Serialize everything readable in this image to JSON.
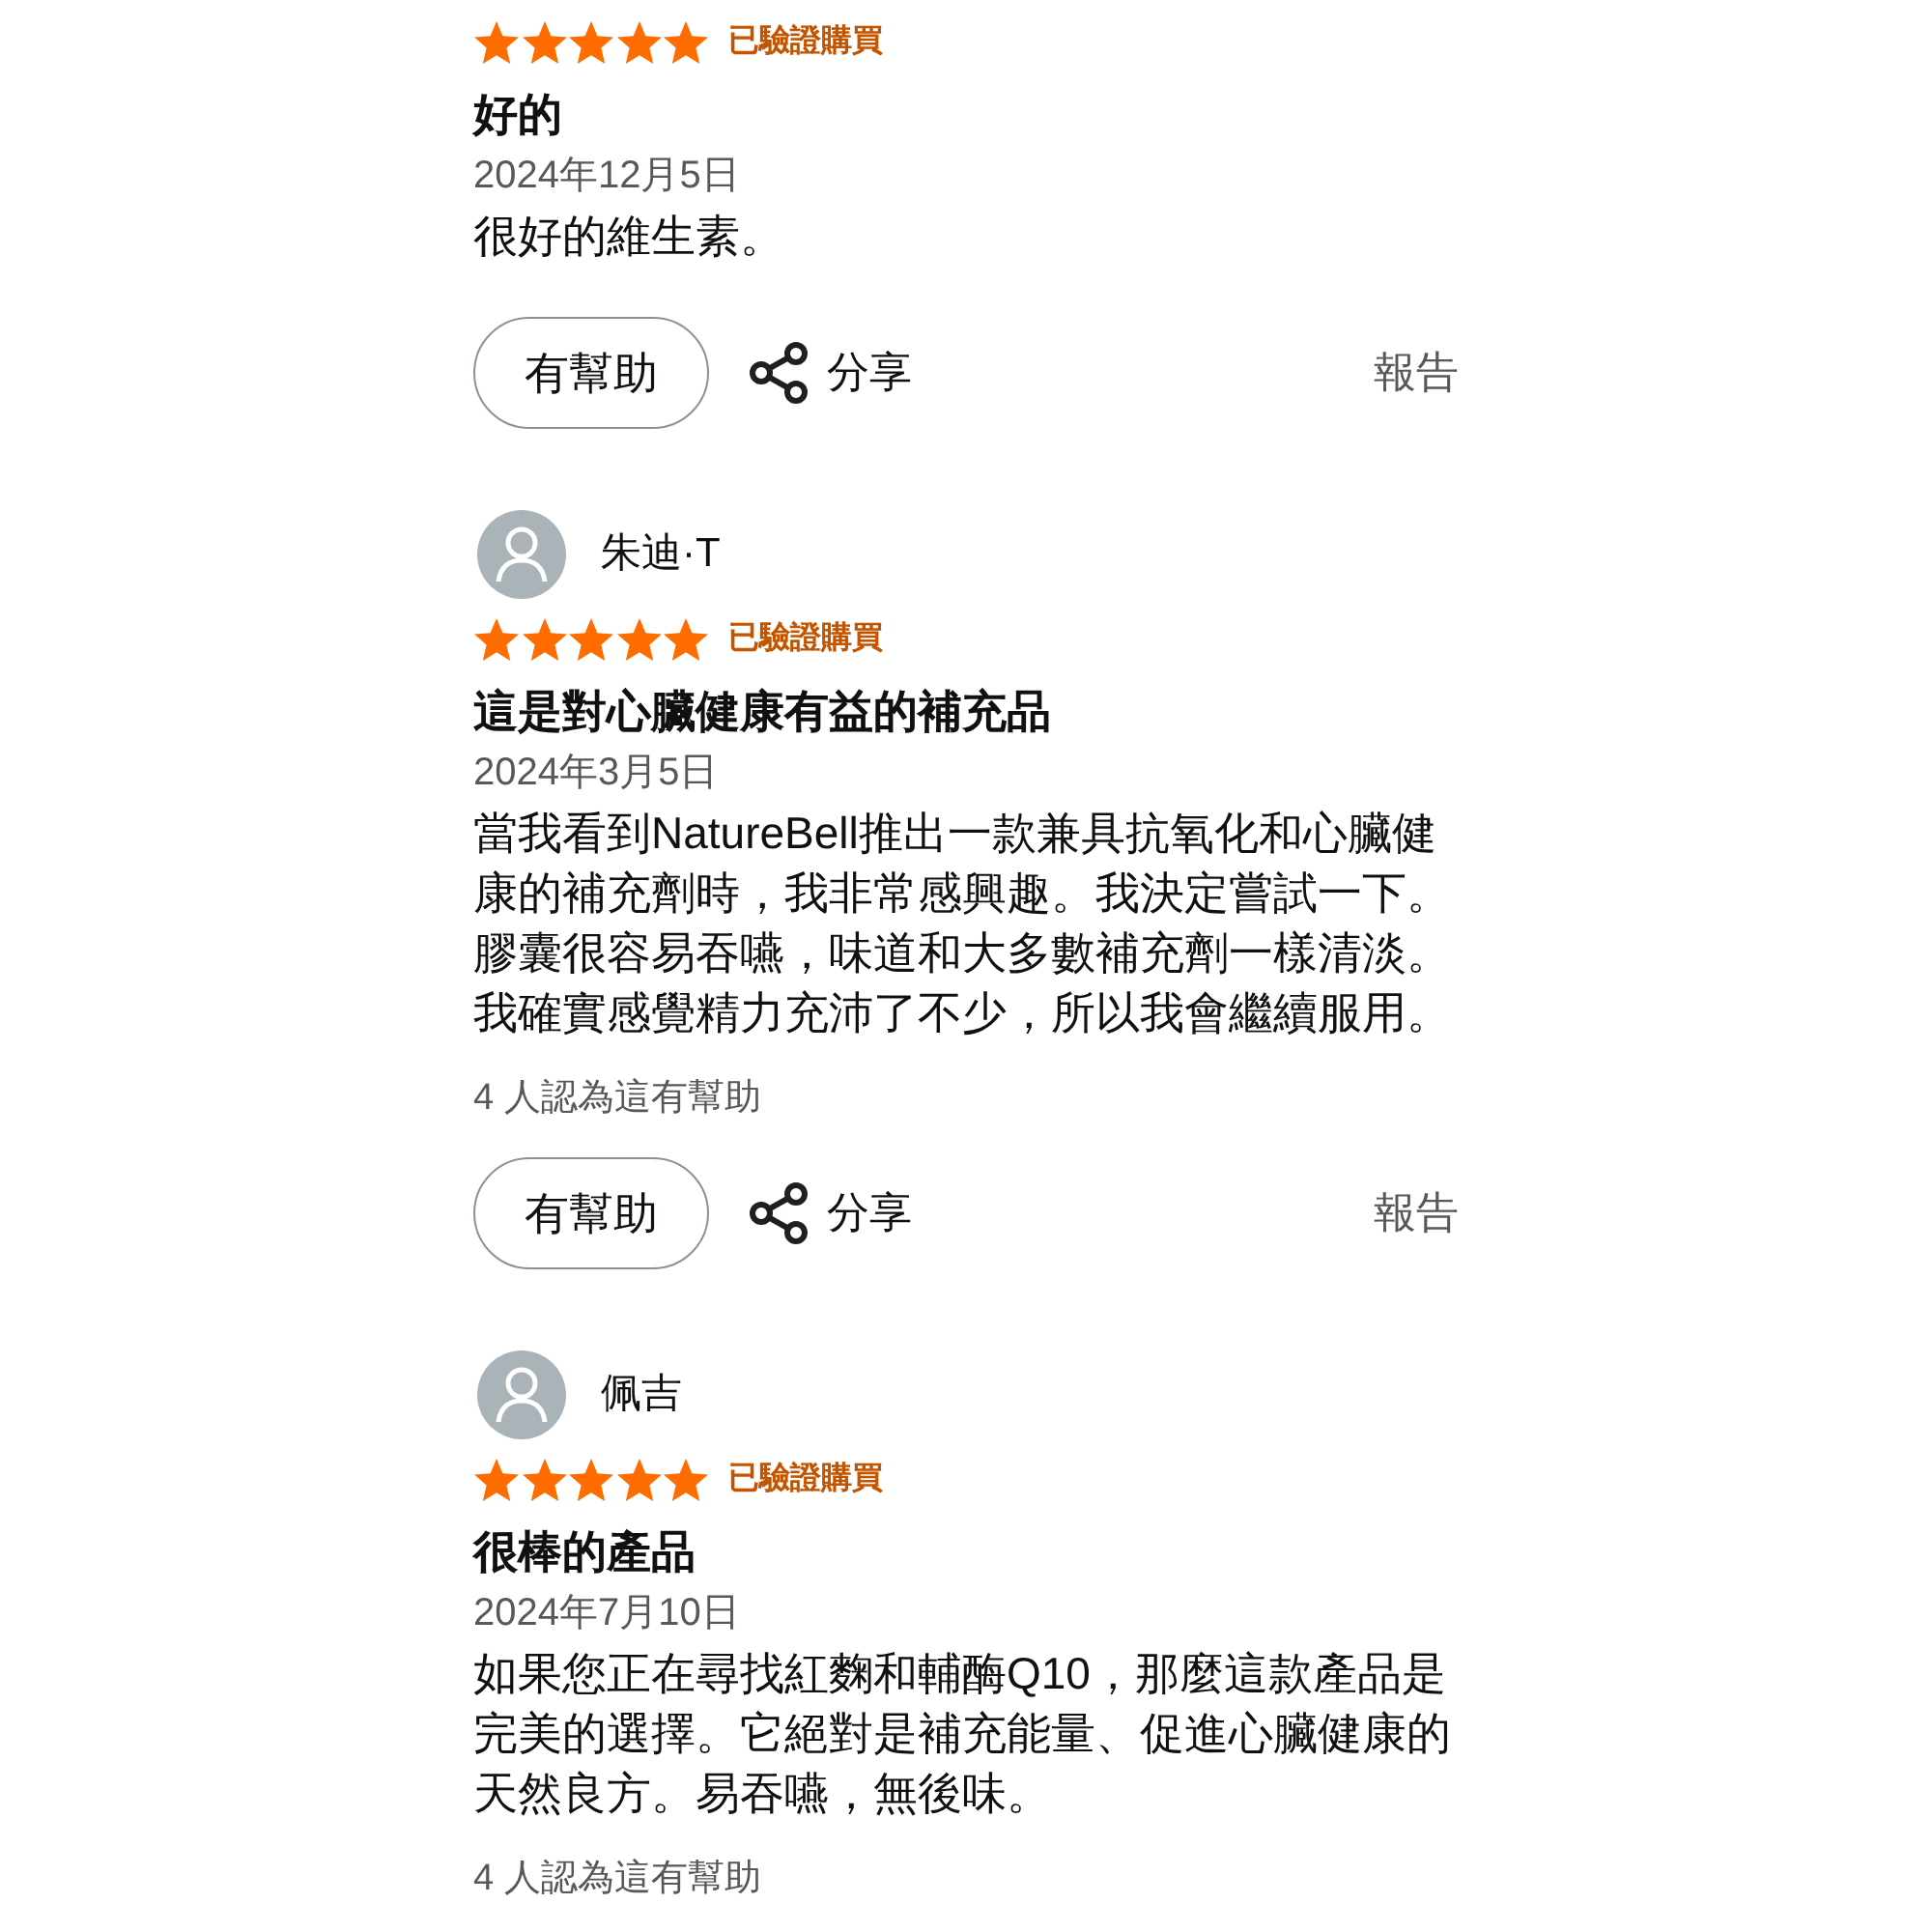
{
  "reviews": [
    {
      "stars": 5,
      "badge": "已驗證購買",
      "title": "好的",
      "date": "2024年12月5日",
      "body": "很好的維生素。",
      "actions": {
        "helpful": "有幫助",
        "share": "分享",
        "report": "報告"
      }
    },
    {
      "reviewer": "朱迪·T",
      "stars": 5,
      "badge": "已驗證購買",
      "title": "這是對心臟健康有益的補充品",
      "date": "2024年3月5日",
      "body": "當我看到NatureBell推出一款兼具抗氧化和心臟健康的補充劑時，我非常感興趣。我決定嘗試一下。膠囊很容易吞嚥，味道和大多數補充劑一樣清淡。我確實感覺精力充沛了不少，所以我會繼續服用。",
      "helpful_count": "4 人認為這有幫助",
      "actions": {
        "helpful": "有幫助",
        "share": "分享",
        "report": "報告"
      }
    },
    {
      "reviewer": "佩吉",
      "stars": 5,
      "badge": "已驗證購買",
      "title": "很棒的產品",
      "date": "2024年7月10日",
      "body": "如果您正在尋找紅麴和輔酶Q10，那麼這款產品是完美的選擇。它絕對是補充能量、促進心臟健康的天然良方。易吞嚥，無後味。",
      "helpful_count": "4 人認為這有幫助"
    }
  ]
}
